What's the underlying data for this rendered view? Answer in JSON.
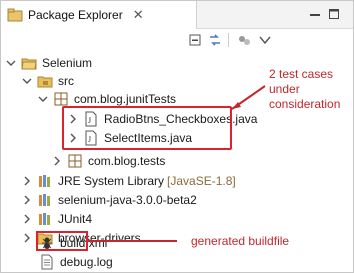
{
  "view": {
    "title": "Package Explorer",
    "close_glyph": "✕"
  },
  "toolbar": {
    "buttons": [
      "collapse-all-icon",
      "link-with-editor-icon",
      "focus-icon",
      "view-menu-icon"
    ]
  },
  "tree": {
    "project": "Selenium",
    "src": "src",
    "pkg_junit": "com.blog.junitTests",
    "file1": "RadioBtns_Checkboxes.java",
    "file2": "SelectItems.java",
    "pkg_tests": "com.blog.tests",
    "jre": "JRE System Library",
    "jre_decor": "[JavaSE-1.8]",
    "selenium_jar": "selenium-java-3.0.0-beta2",
    "junit": "JUnit4",
    "drivers": "browser-drivers",
    "build": "build.xml",
    "debug": "debug.log"
  },
  "annotations": {
    "test_cases_line1": "2 test cases under",
    "test_cases_line2": "consideration",
    "buildfile": "generated buildfile"
  },
  "colors": {
    "annotation": "#c2272d",
    "folder": "#e7c05a",
    "package": "#9b6b2f",
    "java": "#4a6fa5"
  }
}
